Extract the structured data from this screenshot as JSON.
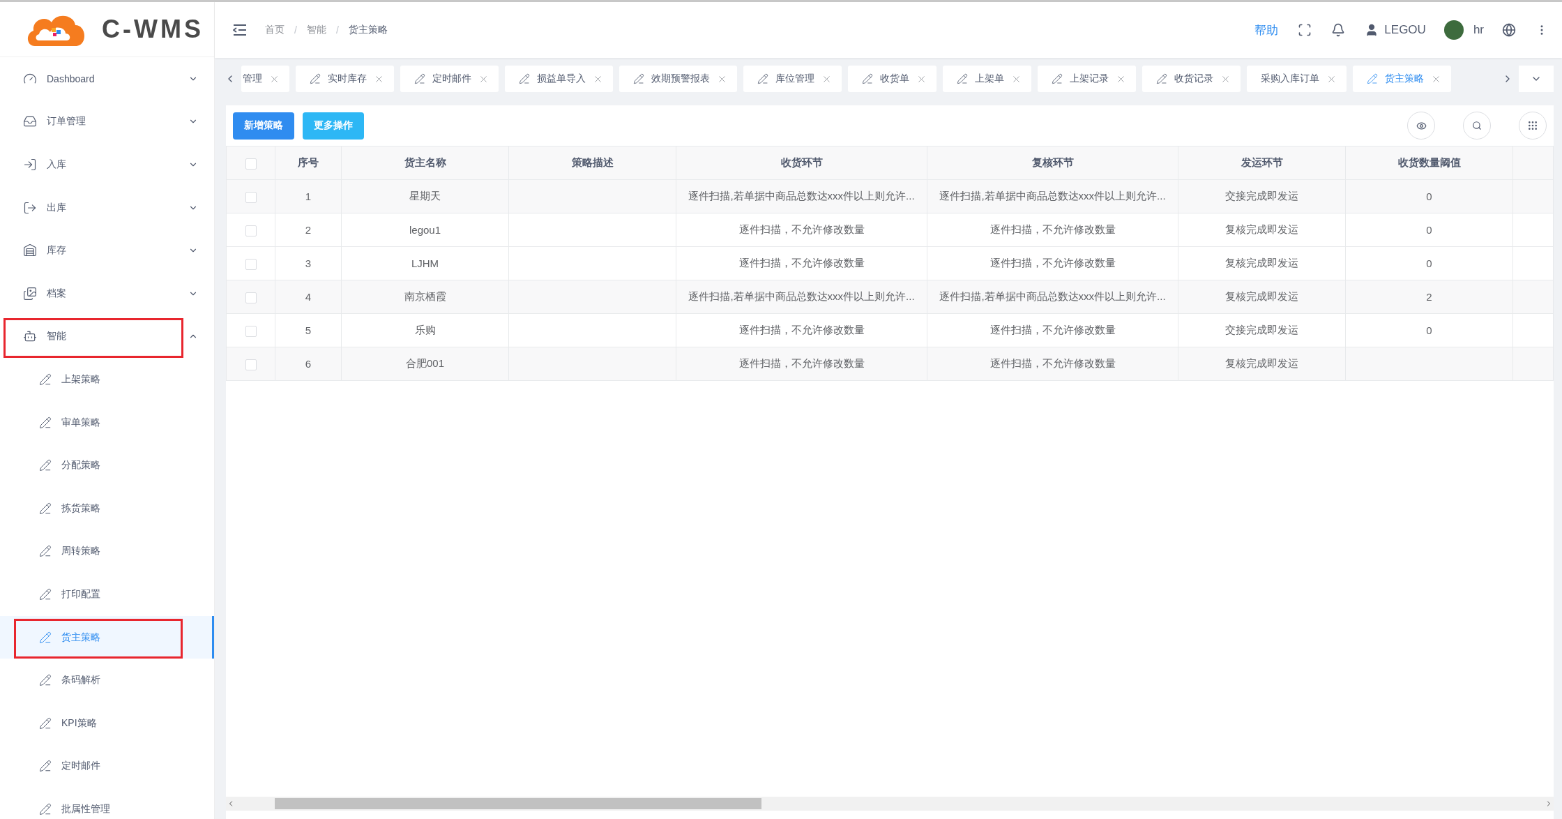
{
  "logo": {
    "text": "C-WMS"
  },
  "sidebar": {
    "items": [
      {
        "label": "Dashboard",
        "expanded": false,
        "annotated": false
      },
      {
        "label": "订单管理",
        "expanded": false,
        "annotated": false
      },
      {
        "label": "入库",
        "expanded": false,
        "annotated": false
      },
      {
        "label": "出库",
        "expanded": false,
        "annotated": false
      },
      {
        "label": "库存",
        "expanded": false,
        "annotated": false
      },
      {
        "label": "档案",
        "expanded": false,
        "annotated": false
      },
      {
        "label": "智能",
        "expanded": true,
        "annotated": true,
        "children": [
          {
            "label": "上架策略",
            "selected": false,
            "annotated": false
          },
          {
            "label": "审单策略",
            "selected": false,
            "annotated": false
          },
          {
            "label": "分配策略",
            "selected": false,
            "annotated": false
          },
          {
            "label": "拣货策略",
            "selected": false,
            "annotated": false
          },
          {
            "label": "周转策略",
            "selected": false,
            "annotated": false
          },
          {
            "label": "打印配置",
            "selected": false,
            "annotated": false
          },
          {
            "label": "货主策略",
            "selected": true,
            "annotated": true
          },
          {
            "label": "条码解析",
            "selected": false,
            "annotated": false
          },
          {
            "label": "KPI策略",
            "selected": false,
            "annotated": false
          },
          {
            "label": "定时邮件",
            "selected": false,
            "annotated": false
          },
          {
            "label": "批属性管理",
            "selected": false,
            "annotated": false
          }
        ]
      }
    ]
  },
  "header": {
    "breadcrumb": [
      "首页",
      "智能",
      "货主策略"
    ],
    "breadcrumb_separator": "/",
    "help": "帮助",
    "user": "LEGOU",
    "account": "hr"
  },
  "tabs": [
    {
      "label": "管理",
      "icon": false,
      "selected": false
    },
    {
      "label": "实时库存",
      "icon": true,
      "selected": false
    },
    {
      "label": "定时邮件",
      "icon": true,
      "selected": false
    },
    {
      "label": "损益单导入",
      "icon": true,
      "selected": false
    },
    {
      "label": "效期预警报表",
      "icon": true,
      "selected": false
    },
    {
      "label": "库位管理",
      "icon": true,
      "selected": false
    },
    {
      "label": "收货单",
      "icon": true,
      "selected": false
    },
    {
      "label": "上架单",
      "icon": true,
      "selected": false
    },
    {
      "label": "上架记录",
      "icon": true,
      "selected": false
    },
    {
      "label": "收货记录",
      "icon": true,
      "selected": false
    },
    {
      "label": "采购入库订单",
      "icon": false,
      "selected": false
    },
    {
      "label": "货主策略",
      "icon": true,
      "selected": true
    }
  ],
  "toolbar": {
    "buttons": [
      {
        "label": "新增策略",
        "kind": "primary"
      },
      {
        "label": "更多操作",
        "kind": "info"
      }
    ]
  },
  "table": {
    "header_checked": false,
    "columns": [
      "序号",
      "货主名称",
      "策略描述",
      "收货环节",
      "复核环节",
      "发运环节",
      "收货数量阈值"
    ],
    "rows": [
      {
        "checked": false,
        "no": "1",
        "owner": "星期天",
        "receiving": "逐件扫描,若单据中商品总数达xxx件以上则允许...",
        "review": "逐件扫描,若单据中商品总数达xxx件以上则允许...",
        "shipping": "交接完成即发运",
        "threshold": "0"
      },
      {
        "checked": false,
        "no": "2",
        "owner": "legou1",
        "receiving": "逐件扫描，不允许修改数量",
        "review": "逐件扫描，不允许修改数量",
        "shipping": "复核完成即发运",
        "threshold": "0"
      },
      {
        "checked": false,
        "no": "3",
        "owner": "LJHM",
        "receiving": "逐件扫描，不允许修改数量",
        "review": "逐件扫描，不允许修改数量",
        "shipping": "复核完成即发运",
        "threshold": "0"
      },
      {
        "checked": false,
        "no": "4",
        "owner": "南京栖霞",
        "receiving": "逐件扫描,若单据中商品总数达xxx件以上则允许...",
        "review": "逐件扫描,若单据中商品总数达xxx件以上则允许...",
        "shipping": "复核完成即发运",
        "threshold": "2"
      },
      {
        "checked": false,
        "no": "5",
        "owner": "乐购",
        "receiving": "逐件扫描，不允许修改数量",
        "review": "逐件扫描，不允许修改数量",
        "shipping": "交接完成即发运",
        "threshold": "0"
      },
      {
        "checked": false,
        "no": "6",
        "owner": "合肥001",
        "receiving": "逐件扫描，不允许修改数量",
        "review": "逐件扫描，不允许修改数量",
        "shipping": "复核完成即发运"
      }
    ]
  }
}
